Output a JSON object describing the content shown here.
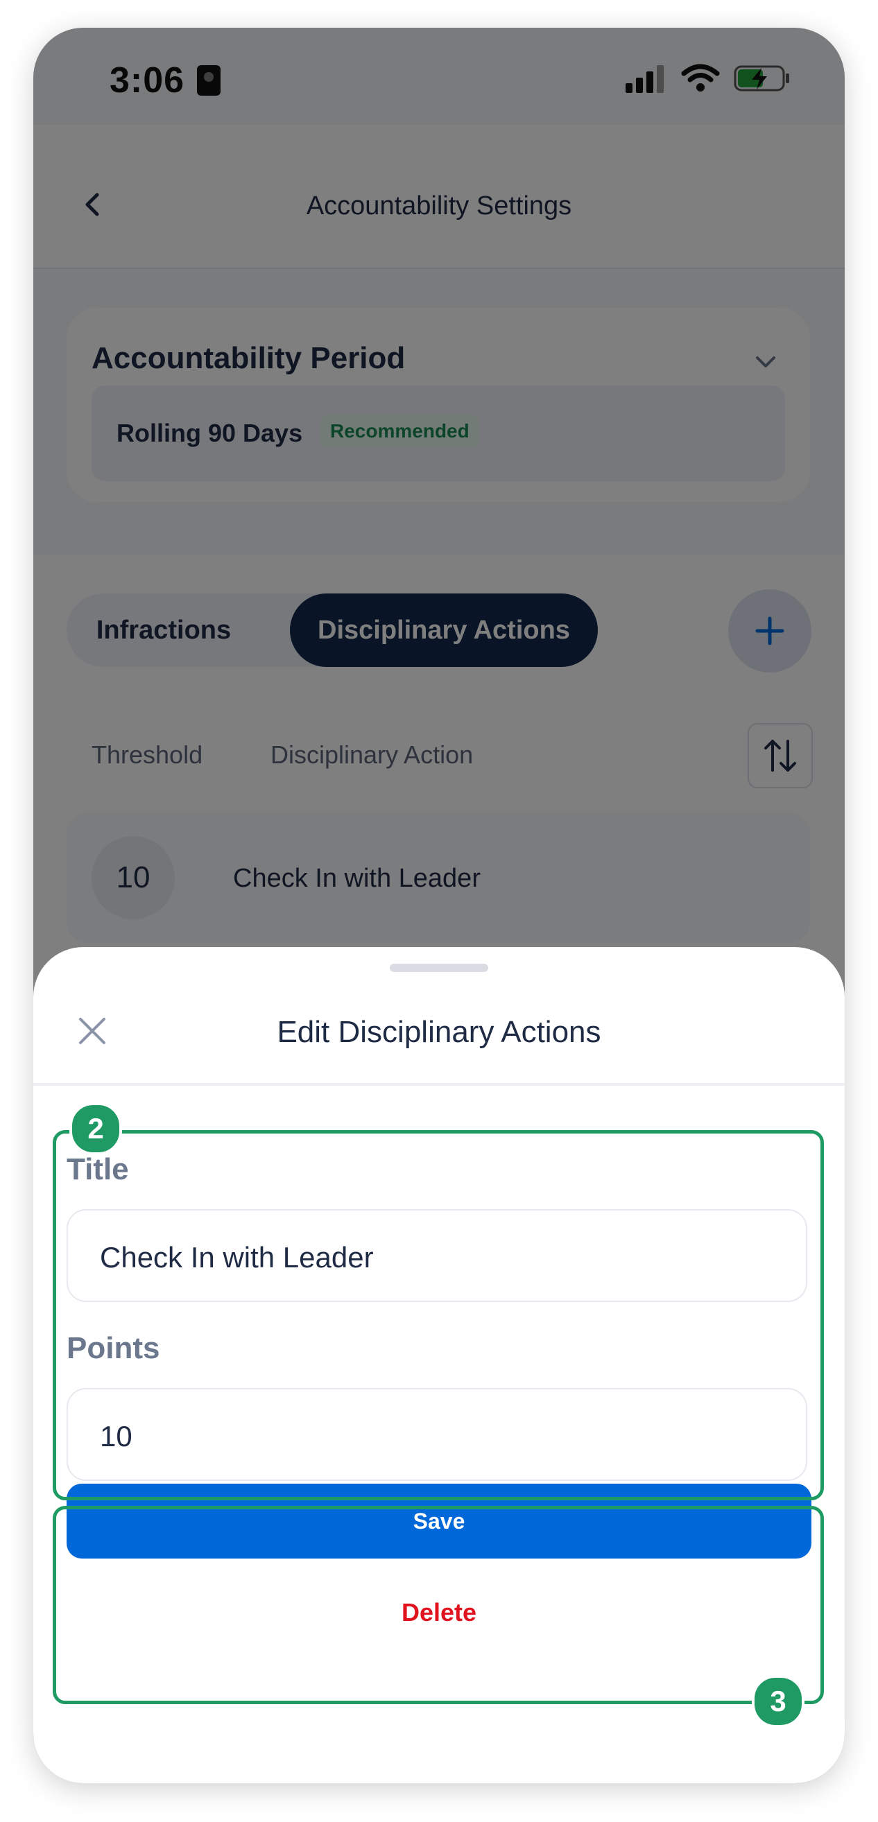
{
  "status_bar": {
    "time": "3:06"
  },
  "nav": {
    "title": "Accountability Settings"
  },
  "period": {
    "title": "Accountability Period",
    "value": "Rolling 90 Days",
    "badge": "Recommended"
  },
  "tabs": [
    {
      "label": "Infractions",
      "active": false
    },
    {
      "label": "Disciplinary Actions",
      "active": true
    }
  ],
  "table": {
    "headers": [
      "Threshold",
      "Disciplinary Action"
    ],
    "rows": [
      {
        "threshold": "10",
        "action": "Check In with Leader"
      }
    ]
  },
  "sheet": {
    "title": "Edit Disciplinary Actions",
    "title_label": "Title",
    "title_value": "Check In with Leader",
    "points_label": "Points",
    "points_value": "10",
    "save_label": "Save",
    "delete_label": "Delete"
  },
  "annotations": [
    {
      "number": "2"
    },
    {
      "number": "3"
    }
  ],
  "colors": {
    "primary": "#0068d9",
    "danger": "#e0141e",
    "annotation": "#1f9a64",
    "navy": "#13284d"
  },
  "icons": [
    "back-icon",
    "chevron-down-icon",
    "plus-icon",
    "sort-icon",
    "close-icon",
    "signal-icon",
    "wifi-icon",
    "battery-charging-icon",
    "id-badge-icon"
  ]
}
